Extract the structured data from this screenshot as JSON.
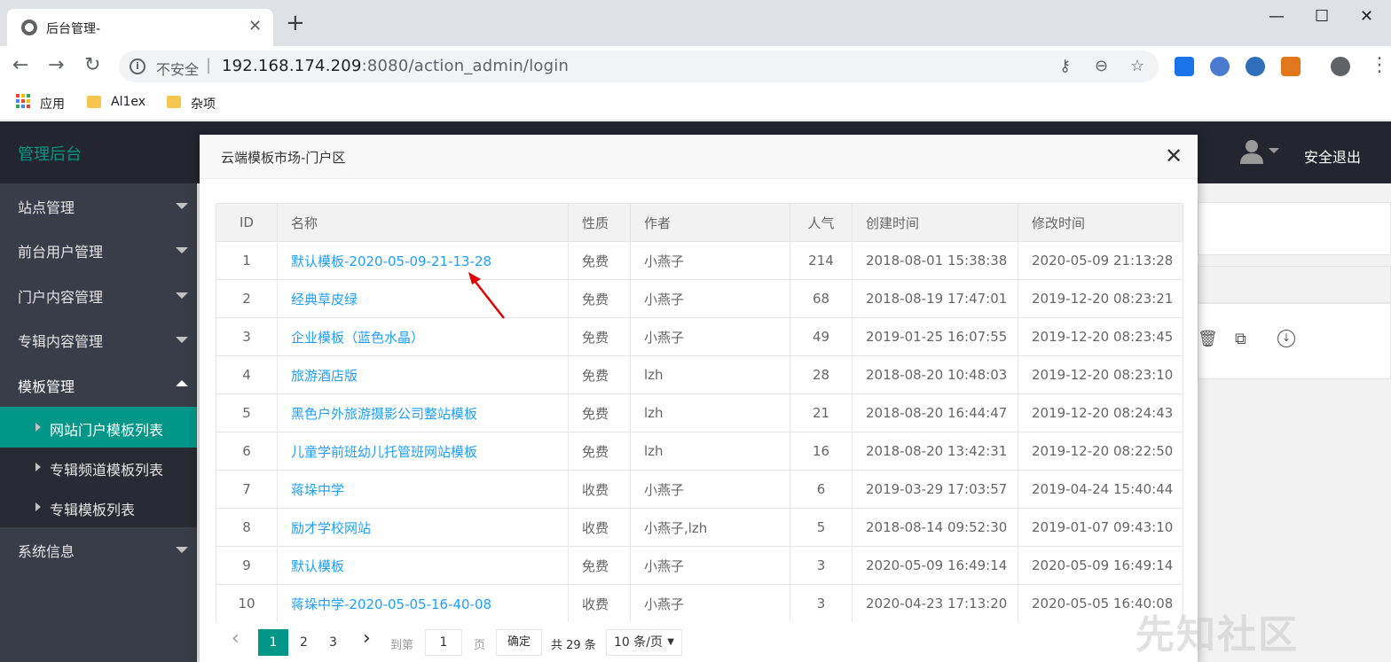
{
  "browser": {
    "tab_title": "后台管理-",
    "new_tab": "+",
    "omnibox": {
      "insecure_label": "不安全",
      "url_host": "192.168.174.209",
      "url_port_path": ":8080/action_admin/login"
    },
    "bookmarks": [
      "应用",
      "Al1ex",
      "杂项"
    ]
  },
  "admin": {
    "brand": "管理后台",
    "logout": "安全退出",
    "sidebar": {
      "items": [
        "站点管理",
        "前台用户管理",
        "门户内容管理",
        "专辑内容管理",
        "模板管理"
      ],
      "sub_items": [
        "网站门户模板列表",
        "专辑频道模板列表",
        "专辑模板列表"
      ],
      "last_item": "系统信息"
    }
  },
  "modal": {
    "title": "云端模板市场-门户区",
    "columns": [
      "ID",
      "名称",
      "性质",
      "作者",
      "人气",
      "创建时间",
      "修改时间"
    ],
    "rows": [
      {
        "id": "1",
        "name": "默认模板-2020-05-09-21-13-28",
        "type": "免费",
        "author": "小燕子",
        "popularity": "214",
        "created": "2018-08-01 15:38:38",
        "modified": "2020-05-09 21:13:28"
      },
      {
        "id": "2",
        "name": "经典草皮绿",
        "type": "免费",
        "author": "小燕子",
        "popularity": "68",
        "created": "2018-08-19 17:47:01",
        "modified": "2019-12-20 08:23:21"
      },
      {
        "id": "3",
        "name": "企业模板（蓝色水晶）",
        "type": "免费",
        "author": "小燕子",
        "popularity": "49",
        "created": "2019-01-25 16:07:55",
        "modified": "2019-12-20 08:23:45"
      },
      {
        "id": "4",
        "name": "旅游酒店版",
        "type": "免费",
        "author": "lzh",
        "popularity": "28",
        "created": "2018-08-20 10:48:03",
        "modified": "2019-12-20 08:23:10"
      },
      {
        "id": "5",
        "name": "黑色户外旅游摄影公司整站模板",
        "type": "免费",
        "author": "lzh",
        "popularity": "21",
        "created": "2018-08-20 16:44:47",
        "modified": "2019-12-20 08:24:43"
      },
      {
        "id": "6",
        "name": "儿童学前班幼儿托管班网站模板",
        "type": "免费",
        "author": "lzh",
        "popularity": "16",
        "created": "2018-08-20 13:42:31",
        "modified": "2019-12-20 08:22:50"
      },
      {
        "id": "7",
        "name": "蒋垛中学",
        "type": "收费",
        "author": "小燕子",
        "popularity": "6",
        "created": "2019-03-29 17:03:57",
        "modified": "2019-04-24 15:40:44"
      },
      {
        "id": "8",
        "name": "励才学校网站",
        "type": "收费",
        "author": "小燕子,lzh",
        "popularity": "5",
        "created": "2018-08-14 09:52:30",
        "modified": "2019-01-07 09:43:10"
      },
      {
        "id": "9",
        "name": "默认模板",
        "type": "免费",
        "author": "小燕子",
        "popularity": "3",
        "created": "2020-05-09 16:49:14",
        "modified": "2020-05-09 16:49:14"
      },
      {
        "id": "10",
        "name": "蒋垛中学-2020-05-05-16-40-08",
        "type": "收费",
        "author": "小燕子",
        "popularity": "3",
        "created": "2020-04-23 17:13:20",
        "modified": "2020-05-05 16:40:08"
      }
    ],
    "pager": {
      "pages": [
        "1",
        "2",
        "3"
      ],
      "goto_label": "到第",
      "goto_value": "1",
      "page_unit": "页",
      "confirm": "确定",
      "total": "共 29 条",
      "per_page": "10 条/页"
    }
  },
  "colors": {
    "accent": "#009688",
    "link": "#1e9fff",
    "paid": "#ff2222",
    "sidebar": "#393d49",
    "topbar": "#23262e"
  },
  "watermark": "先知社区"
}
